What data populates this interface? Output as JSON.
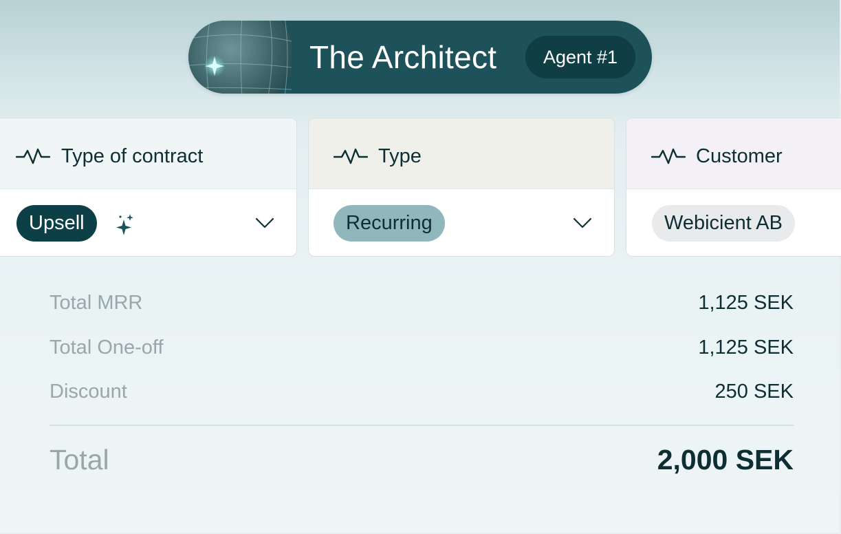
{
  "agent": {
    "name": "The Architect",
    "badge": "Agent #1",
    "icon": "globe-icon"
  },
  "fields": [
    {
      "label": "Type of contract",
      "icon": "activity-pulse-icon",
      "header_color": "#f0f5f6",
      "value": "Upsell",
      "chip_color": "#0d3f46",
      "ai_suggested": true,
      "dropdown": true
    },
    {
      "label": "Type",
      "icon": "activity-pulse-icon",
      "header_color": "#eff0ea",
      "value": "Recurring",
      "chip_color": "#8fb7bc",
      "dropdown": true
    },
    {
      "label": "Customer",
      "icon": "activity-pulse-icon",
      "header_color": "#f3f1f5",
      "value": "Webicient AB",
      "chip_color": "#e9eaeb"
    }
  ],
  "summary": {
    "rows": [
      {
        "label": "Total MRR",
        "value": "1,125 SEK"
      },
      {
        "label": "Total One-off",
        "value": "1,125 SEK"
      },
      {
        "label": "Discount",
        "value": "250 SEK"
      }
    ],
    "total": {
      "label": "Total",
      "value": "2,000 SEK"
    }
  }
}
